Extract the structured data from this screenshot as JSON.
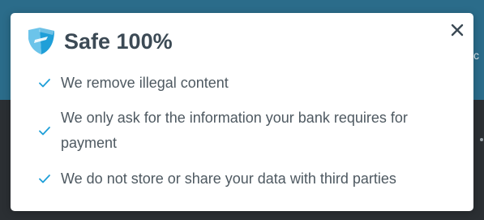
{
  "background": {
    "peek_line_1": "",
    "peek_line_2": "c"
  },
  "modal": {
    "title": "Safe 100%",
    "close_label": "×",
    "items": [
      {
        "text": "We remove illegal content"
      },
      {
        "text": "We only ask for the information your bank requires for payment"
      },
      {
        "text": "We do not store or share your data with third parties"
      }
    ]
  },
  "colors": {
    "accent": "#1f9fd8",
    "title": "#3c4a55",
    "text": "#4e5961",
    "header_bg": "#2b6c8a",
    "page_bg": "#2b2f33"
  },
  "icons": {
    "brand": "shield-icon",
    "close": "close-icon",
    "bullet": "check-icon"
  }
}
